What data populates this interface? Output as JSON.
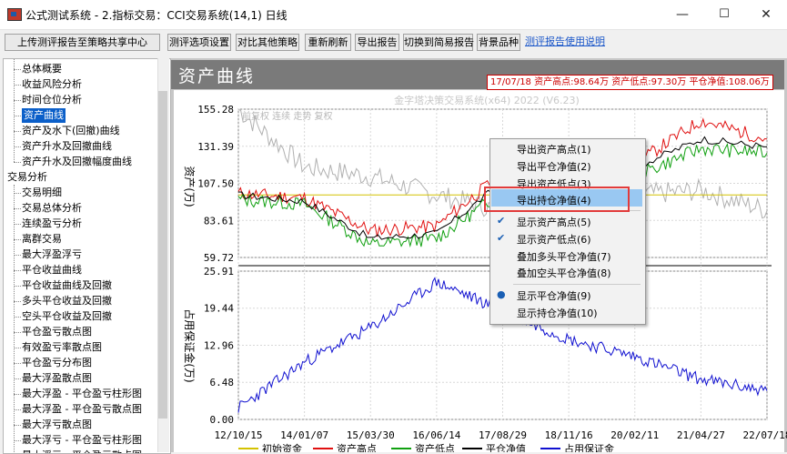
{
  "window": {
    "title": "公式测试系统 - 2.指标交易：CCI交易系统(14,1) 日线",
    "controls": {
      "minimize": "—",
      "maximize": "☐",
      "close": "✕"
    }
  },
  "toolbar": {
    "upload": "上传测评报告至策略共享中心",
    "settings": "测评选项设置",
    "compare": "对比其他策略",
    "refresh": "重新刷新",
    "export": "导出报告",
    "switch_simple": "切换到简易报告",
    "bg_variety": "背景品种",
    "help": "测评报告使用说明"
  },
  "tree": {
    "items": [
      {
        "label": "总体概要",
        "level": 1
      },
      {
        "label": "收益风险分析",
        "level": 1
      },
      {
        "label": "时间仓位分析",
        "level": 1
      },
      {
        "label": "资产曲线",
        "level": 1,
        "selected": true
      },
      {
        "label": "资产及水下(回撤)曲线",
        "level": 1
      },
      {
        "label": "资产升水及回撤曲线",
        "level": 1
      },
      {
        "label": "资产升水及回撤幅度曲线",
        "level": 1
      },
      {
        "label": "交易分析",
        "level": 0
      },
      {
        "label": "交易明细",
        "level": 1
      },
      {
        "label": "交易总体分析",
        "level": 1
      },
      {
        "label": "连续盈亏分析",
        "level": 1
      },
      {
        "label": "离群交易",
        "level": 1
      },
      {
        "label": "最大浮盈浮亏",
        "level": 1
      },
      {
        "label": "平仓收益曲线",
        "level": 1
      },
      {
        "label": "平仓收益曲线及回撤",
        "level": 1
      },
      {
        "label": "多头平仓收益及回撤",
        "level": 1
      },
      {
        "label": "空头平仓收益及回撤",
        "level": 1
      },
      {
        "label": "平仓盈亏散点图",
        "level": 1
      },
      {
        "label": "有效盈亏率散点图",
        "level": 1
      },
      {
        "label": "平仓盈亏分布图",
        "level": 1
      },
      {
        "label": "最大浮盈散点图",
        "level": 1
      },
      {
        "label": "最大浮盈 - 平仓盈亏柱形图",
        "level": 1
      },
      {
        "label": "最大浮盈 - 平仓盈亏散点图",
        "level": 1
      },
      {
        "label": "最大浮亏散点图",
        "level": 1
      },
      {
        "label": "最大浮亏 - 平仓盈亏柱形图",
        "level": 1
      },
      {
        "label": "最大浮亏 - 平仓盈亏散点图",
        "level": 1
      }
    ]
  },
  "chart": {
    "title": "资产曲线",
    "stats": "17/07/18 资产高点:98.64万  资产低点:97.30万  平仓净值:108.06万",
    "watermark": "金字塔决策交易系统(x64) 2022 (V6.23)",
    "inner_label": "前复权 连续 走势 复权",
    "upper_ylabel": "资产(万)",
    "lower_ylabel": "占用保证金(万)",
    "upper_ticks": [
      "155.28",
      "131.39",
      "107.50",
      "83.61",
      "59.72"
    ],
    "lower_ticks": [
      "25.91",
      "19.44",
      "12.96",
      "6.48",
      "0.00"
    ],
    "x_ticks": [
      "12/10/15",
      "14/01/07",
      "15/03/30",
      "16/06/14",
      "17/08/29",
      "18/11/16",
      "20/02/11",
      "21/04/27",
      "22/07/18"
    ],
    "legend": [
      "初始资金",
      "资产高点",
      "资产低点",
      "平仓净值",
      "占用保证金"
    ],
    "colors": {
      "initial": "#d4c200",
      "high": "#e01010",
      "low": "#10a010",
      "close": "#000000",
      "margin": "#1010d0",
      "bg_variety": "#b0b0b0"
    }
  },
  "context_menu": {
    "items": [
      {
        "label": "导出资产高点(1)",
        "checked": false
      },
      {
        "label": "导出平仓净值(2)",
        "checked": false
      },
      {
        "label": "导出资产低点(3)",
        "checked": false
      },
      {
        "label": "导出持仓净值(4)",
        "checked": false,
        "highlighted": true
      },
      {
        "label": "显示资产高点(5)",
        "checked": true
      },
      {
        "label": "显示资产低点(6)",
        "checked": true
      },
      {
        "label": "叠加多头平仓净值(7)",
        "checked": false
      },
      {
        "label": "叠加空头平仓净值(8)",
        "checked": false
      },
      {
        "label": "显示平仓净值(9)",
        "checked": true,
        "radio": true
      },
      {
        "label": "显示持仓净值(10)",
        "checked": false
      }
    ]
  },
  "chart_data": {
    "type": "line",
    "x_ticks": [
      "12/10/15",
      "14/01/07",
      "15/03/30",
      "16/06/14",
      "17/08/29",
      "18/11/16",
      "20/02/11",
      "21/04/27",
      "22/07/18"
    ],
    "panels": [
      {
        "ylabel": "资产(万)",
        "ylim": [
          59.72,
          155.28
        ],
        "ticks": [
          155.28,
          131.39,
          107.5,
          83.61,
          59.72
        ],
        "series": [
          {
            "name": "初始资金",
            "values": [
              100,
              100,
              100,
              100,
              100,
              100,
              100,
              100,
              100
            ]
          },
          {
            "name": "平仓净值",
            "values": [
              100,
              96,
              72,
              75,
              108,
              103,
              118,
              136,
              131
            ]
          },
          {
            "name": "资产高点",
            "values": [
              101,
              98,
              77,
              80,
              114,
              108,
              120,
              148,
              136
            ]
          },
          {
            "name": "资产低点",
            "values": [
              97,
              94,
              68,
              72,
              102,
              98,
              112,
              130,
              127
            ]
          }
        ]
      },
      {
        "ylabel": "占用保证金(万)",
        "ylim": [
          0,
          25.91
        ],
        "ticks": [
          25.91,
          19.44,
          12.96,
          6.48,
          0.0
        ],
        "series": [
          {
            "name": "占用保证金",
            "values": [
              2,
              10,
              16,
              24,
              19,
              14,
              11,
              7,
              5
            ]
          }
        ]
      }
    ]
  }
}
